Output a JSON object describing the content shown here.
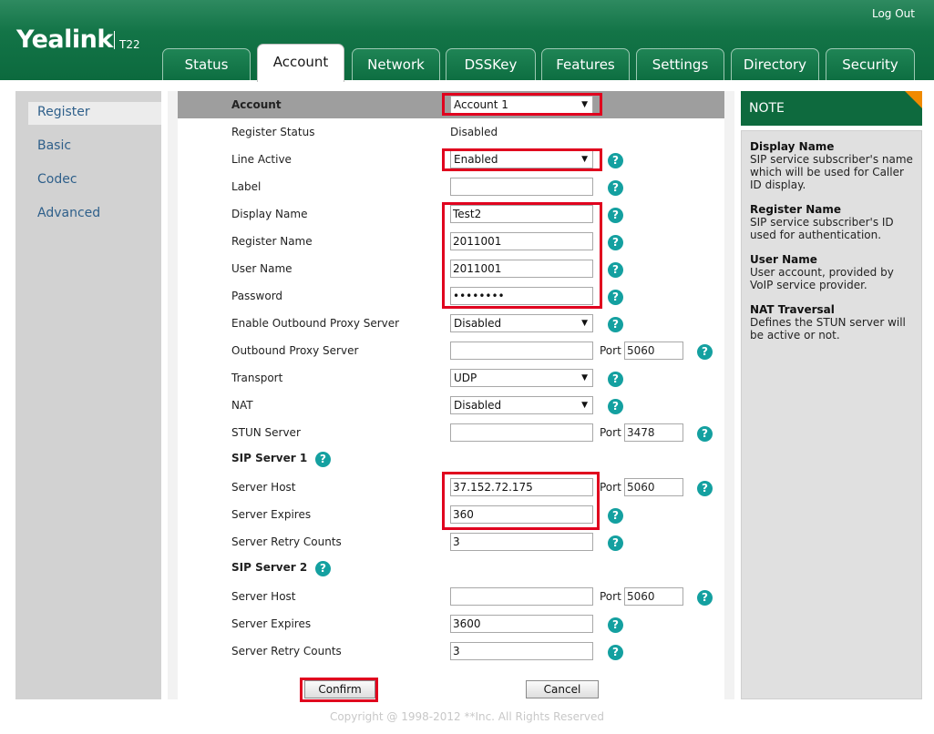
{
  "header": {
    "brand": "Yealink",
    "model": "T22",
    "logout": "Log Out",
    "tabs": [
      {
        "label": "Status"
      },
      {
        "label": "Account"
      },
      {
        "label": "Network"
      },
      {
        "label": "DSSKey"
      },
      {
        "label": "Features"
      },
      {
        "label": "Settings"
      },
      {
        "label": "Directory"
      },
      {
        "label": "Security"
      }
    ],
    "active_tab": "Account"
  },
  "sidebar": {
    "items": [
      {
        "label": "Register"
      },
      {
        "label": "Basic"
      },
      {
        "label": "Codec"
      },
      {
        "label": "Advanced"
      }
    ],
    "active": "Register"
  },
  "form": {
    "account_label": "Account",
    "account_value": "Account 1",
    "register_status_label": "Register Status",
    "register_status_value": "Disabled",
    "line_active_label": "Line Active",
    "line_active_value": "Enabled",
    "label_label": "Label",
    "label_value": "",
    "display_name_label": "Display Name",
    "display_name_value": "Test2",
    "register_name_label": "Register Name",
    "register_name_value": "2011001",
    "user_name_label": "User Name",
    "user_name_value": "2011001",
    "password_label": "Password",
    "password_value": "••••••••",
    "outbound_proxy_enable_label": "Enable Outbound Proxy Server",
    "outbound_proxy_enable_value": "Disabled",
    "outbound_proxy_label": "Outbound Proxy Server",
    "outbound_proxy_value": "",
    "outbound_proxy_port": "5060",
    "transport_label": "Transport",
    "transport_value": "UDP",
    "nat_label": "NAT",
    "nat_value": "Disabled",
    "stun_label": "STUN Server",
    "stun_value": "",
    "stun_port": "3478",
    "port_label": "Port",
    "sip1": {
      "title": "SIP Server 1",
      "host_label": "Server Host",
      "host_value": "37.152.72.175",
      "port": "5060",
      "expires_label": "Server Expires",
      "expires_value": "360",
      "retry_label": "Server Retry Counts",
      "retry_value": "3"
    },
    "sip2": {
      "title": "SIP Server 2",
      "host_label": "Server Host",
      "host_value": "",
      "port": "5060",
      "expires_label": "Server Expires",
      "expires_value": "3600",
      "retry_label": "Server Retry Counts",
      "retry_value": "3"
    },
    "confirm": "Confirm",
    "cancel": "Cancel",
    "help_glyph": "?"
  },
  "note": {
    "heading": "NOTE",
    "entries": [
      {
        "title": "Display Name",
        "text": "SIP service subscriber's name which will be used for Caller ID display."
      },
      {
        "title": "Register Name",
        "text": "SIP service subscriber's ID used for authentication."
      },
      {
        "title": "User Name",
        "text": "User account, provided by VoIP service provider."
      },
      {
        "title": "NAT Traversal",
        "text": "Defines the STUN server will be active or not."
      }
    ]
  },
  "footer": "Copyright @ 1998-2012 **Inc. All Rights Reserved",
  "colors": {
    "header_green": "#0c6a3e",
    "highlight_red": "#e0001e",
    "help_teal": "#14a0a0",
    "note_accent": "#f08a00"
  }
}
